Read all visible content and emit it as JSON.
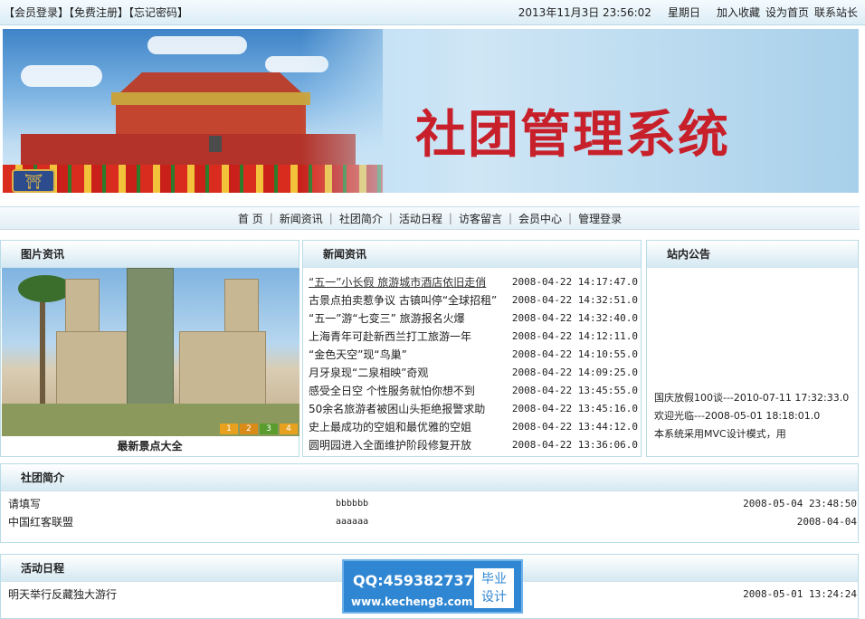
{
  "topbar": {
    "member_login": "【会员登录】",
    "register": "【免费注册】",
    "forgot_password": "【忘记密码】",
    "datetime": "2013年11月3日 23:56:02",
    "weekday": "星期日",
    "add_favorite": "加入收藏",
    "set_homepage": "设为首页",
    "contact": "联系站长"
  },
  "banner": {
    "title": "社团管理系统"
  },
  "nav": {
    "items": [
      "首 页",
      "新闻资讯",
      "社团简介",
      "活动日程",
      "访客留言",
      "会员中心",
      "管理登录"
    ]
  },
  "pic_panel": {
    "heading": "图片资讯",
    "caption": "最新景点大全",
    "pagers": [
      "1",
      "2",
      "3",
      "4"
    ]
  },
  "news_panel": {
    "heading": "新闻资讯",
    "items": [
      {
        "title": "“五一”小长假 旅游城市酒店依旧走俏",
        "date": "2008-04-22 14:17:47.0"
      },
      {
        "title": "古景点拍卖惹争议 古镇叫停“全球招租”",
        "date": "2008-04-22 14:32:51.0"
      },
      {
        "title": "“五一”游“七变三” 旅游报名火爆",
        "date": "2008-04-22 14:32:40.0"
      },
      {
        "title": "上海青年可赴新西兰打工旅游一年",
        "date": "2008-04-22 14:12:11.0"
      },
      {
        "title": "“金色天空”现“鸟巢”",
        "date": "2008-04-22 14:10:55.0"
      },
      {
        "title": "月牙泉现“二泉相映”奇观",
        "date": "2008-04-22 14:09:25.0"
      },
      {
        "title": "感受全日空 个性服务就怕你想不到",
        "date": "2008-04-22 13:45:55.0"
      },
      {
        "title": "50余名旅游者被困山头拒绝报警求助",
        "date": "2008-04-22 13:45:16.0"
      },
      {
        "title": "史上最成功的空姐和最优雅的空姐",
        "date": "2008-04-22 13:44:12.0"
      },
      {
        "title": "圆明园进入全面维护阶段修复开放",
        "date": "2008-04-22 13:36:06.0"
      }
    ]
  },
  "notice_panel": {
    "heading": "站内公告",
    "items": [
      "国庆放假100谈---2010-07-11 17:32:33.0",
      "欢迎光临---2008-05-01 18:18:01.0",
      "本系统采用MVC设计模式，用"
    ]
  },
  "club_panel": {
    "heading": "社团简介",
    "rows": [
      {
        "name": "请填写",
        "desc": "bbbbbb",
        "date": "2008-05-04 23:48:50"
      },
      {
        "name": "中国红客联盟",
        "desc": "aaaaaa",
        "date": "2008-04-04"
      }
    ]
  },
  "activity_panel": {
    "heading": "活动日程",
    "rows": [
      {
        "name": "明天举行反藏独大游行",
        "desc": "",
        "date": "2008-05-01 13:24:24"
      }
    ]
  },
  "watermark": {
    "qq": "QQ:459382737",
    "url": "www.kecheng8.com",
    "side_line1": "毕业",
    "side_line2": "设计"
  }
}
